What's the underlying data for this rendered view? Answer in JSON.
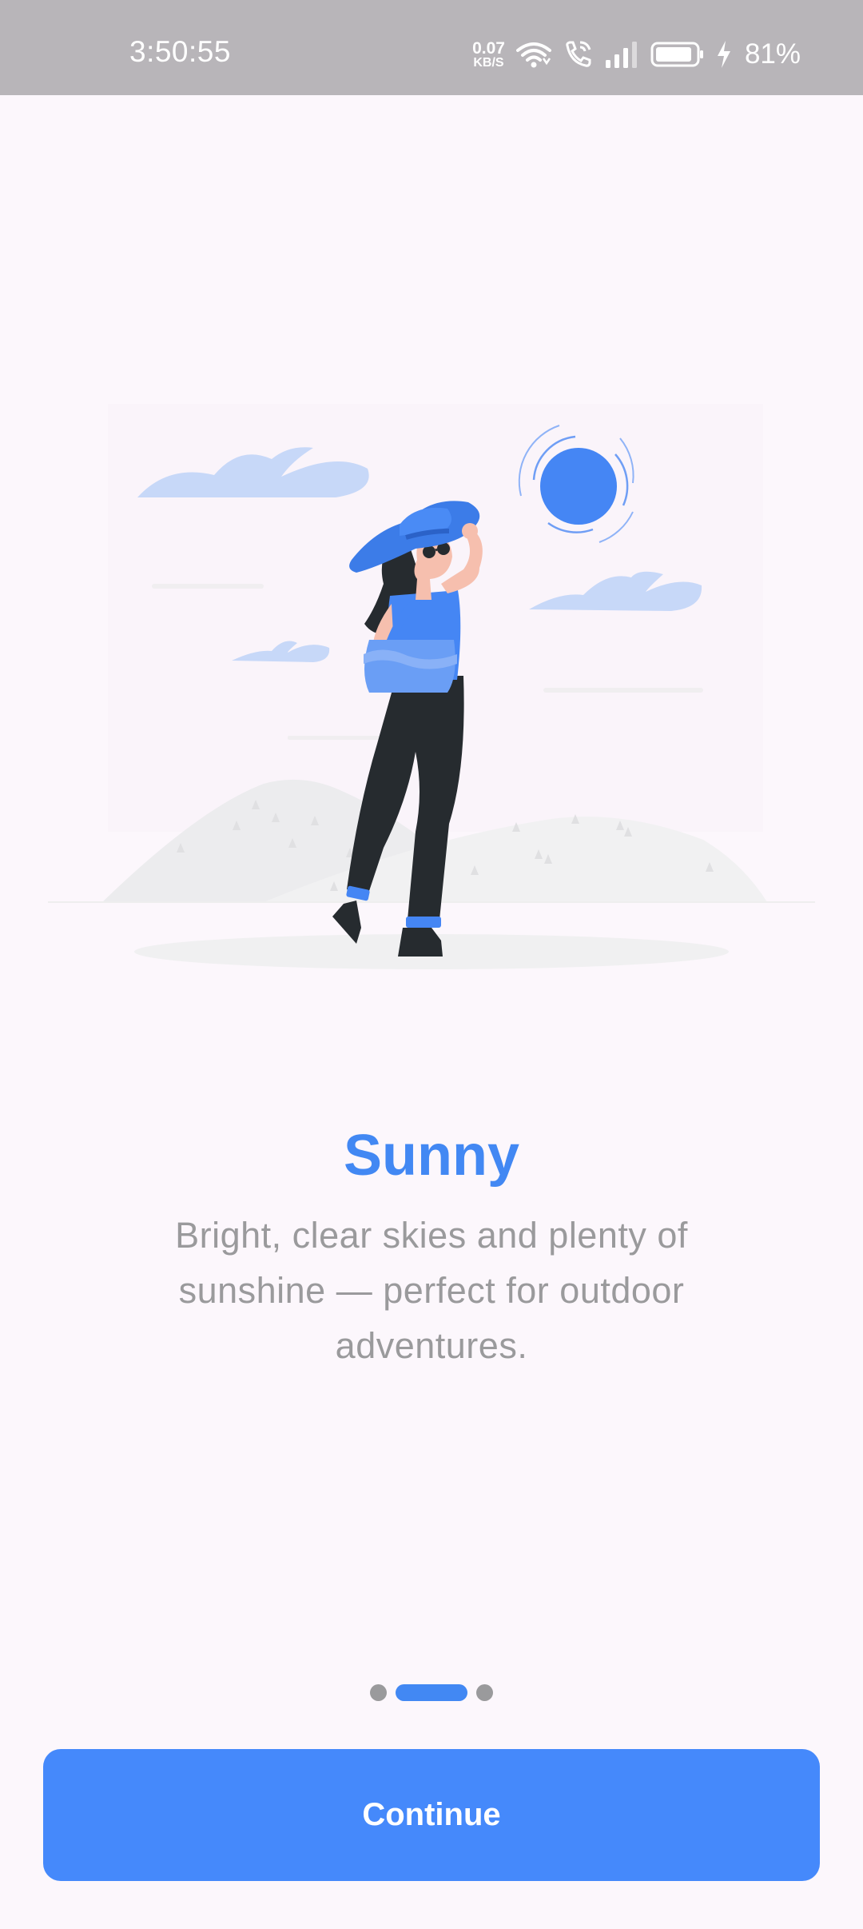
{
  "status_bar": {
    "time": "3:50:55",
    "net_speed_value": "0.07",
    "net_speed_unit": "KB/S",
    "battery_percent": "81%",
    "icons": [
      "wifi-icon",
      "wifi-calling-icon",
      "signal-icon",
      "battery-icon",
      "charging-icon"
    ]
  },
  "onboarding": {
    "illustration": "woman-in-sun-hat-illustration",
    "title": "Sunny",
    "description": "Bright, clear skies and plenty of sunshine — perfect for outdoor adventures.",
    "page_count": 3,
    "active_page": 2
  },
  "actions": {
    "continue_label": "Continue"
  },
  "colors": {
    "accent": "#4288f3",
    "button": "#4589fb",
    "background": "#fcf7fc",
    "status_bar": "#b8b5b9",
    "muted_text": "#9a9a9c"
  }
}
